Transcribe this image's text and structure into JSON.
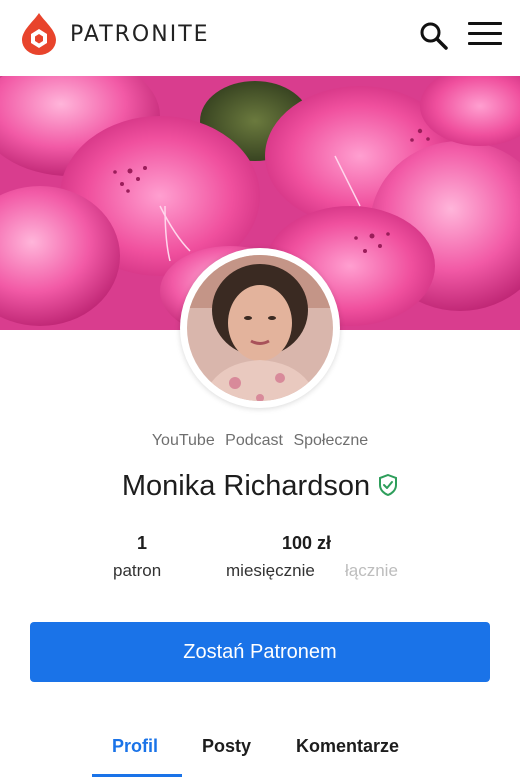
{
  "header": {
    "brand": "PATRONITE",
    "logo_icon": "patronite-drop-logo-icon",
    "search_icon": "search-icon",
    "menu_icon": "hamburger-menu-icon"
  },
  "cover": {
    "image": "pink-rhododendron-flowers"
  },
  "profile": {
    "avatar": "creator-avatar-photo",
    "categories": [
      "YouTube",
      "Podcast",
      "Społeczne"
    ],
    "name": "Monika Richardson",
    "verified_icon": "verified-shield-icon"
  },
  "stats": {
    "patrons_value": "1",
    "patrons_label": "patron",
    "amount_value": "100 zł",
    "period_monthly": "miesięcznie",
    "period_total": "łącznie"
  },
  "cta": {
    "label": "Zostań Patronem"
  },
  "tabs": [
    {
      "label": "Profil",
      "active": true
    },
    {
      "label": "Posty",
      "active": false
    },
    {
      "label": "Komentarze",
      "active": false
    }
  ],
  "colors": {
    "accent": "#1a73e8",
    "brand_red": "#e8442c",
    "verified_green": "#2e9e5b"
  }
}
